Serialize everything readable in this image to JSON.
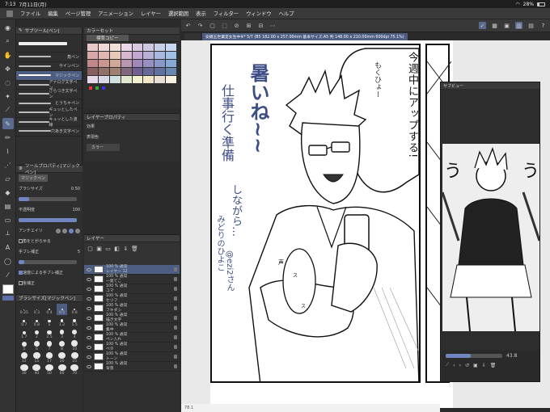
{
  "status": {
    "time": "7:13",
    "date": "7月11日(月)",
    "battery": "28%"
  },
  "menu": [
    "ファイル",
    "編集",
    "ページ管理",
    "アニメーション",
    "レイヤー",
    "選択範囲",
    "表示",
    "フィルター",
    "ウィンドウ",
    "ヘルプ"
  ],
  "subtool": {
    "title": "サブツール[ペン]",
    "items": [
      {
        "label": "角ペン",
        "selected": false
      },
      {
        "label": "サインペン",
        "selected": false
      },
      {
        "label": "マジックペン",
        "selected": true
      },
      {
        "label": "アナログ文字ペン",
        "selected": false
      },
      {
        "label": "ざらつき文字ペン",
        "selected": false
      },
      {
        "label": "とうちゃペン",
        "selected": false
      },
      {
        "label": "ギュッとしたペン",
        "selected": false
      },
      {
        "label": "キュッとした波線",
        "selected": false
      },
      {
        "label": "穴あき文字ペン",
        "selected": false
      }
    ]
  },
  "toolprop": {
    "title": "ツールプロパティ[マジックペン]",
    "name": "マジックペン",
    "brush_size_label": "ブラシサイズ",
    "brush_size_value": "0.50",
    "opacity_label": "不透明度",
    "opacity_value": "100",
    "antialias_label": "アンチエイリ",
    "corner_label": "角をとがらせる",
    "stabilize_label": "手ブレ補正",
    "stabilize_value": "5",
    "speed_label": "速度による手ブレ補正",
    "post_label": "後補正"
  },
  "sizepanel": {
    "title": "ブラシサイズ[マジックペン]",
    "sizes": [
      "0.25",
      "0.3",
      "0.4",
      "0.5",
      "0.6",
      "0.7",
      "0.8",
      "1",
      "1.2",
      "1.5",
      "1.7",
      "2",
      "2.5",
      "3",
      "4",
      "5",
      "6",
      "7",
      "8",
      "10",
      "12",
      "15",
      "17",
      "20",
      "25",
      "30",
      "40",
      "50",
      "60",
      "70"
    ]
  },
  "colorset": {
    "title": "カラーセット",
    "preset": "標準コピー",
    "colors": [
      "#e8c8c8",
      "#f0d8d8",
      "#f0e0d8",
      "#e8d8e8",
      "#d8c8e0",
      "#d0c8e0",
      "#c8d0e8",
      "#c8d8f0",
      "#d8a8a8",
      "#e0b8b0",
      "#e8c8b8",
      "#d8b8d0",
      "#c0a8d0",
      "#b8b0d8",
      "#a8b8e0",
      "#a0c0e8",
      "#c08888",
      "#c89890",
      "#d0a898",
      "#b898b0",
      "#a088b8",
      "#9890c0",
      "#8898c8",
      "#88a8d8",
      "#886060",
      "#907068",
      "#a08070",
      "#806880",
      "#706090",
      "#686898",
      "#6070a0",
      "#6888b0",
      "#e8d8e8",
      "#d8d8e8",
      "#d0e0e0",
      "#e0e8d0",
      "#f0f0d0",
      "#f0e8c8",
      "#e8e0d8",
      "#f8f0e0"
    ]
  },
  "layerprop": {
    "title": "レイヤープロパティ",
    "effect_label": "効果",
    "color_label": "表現色",
    "color_value": "カラー"
  },
  "layers": {
    "title": "レイヤー",
    "items": [
      {
        "percent": "100 %",
        "mode": "通常",
        "name": "レイヤー 12",
        "selected": true
      },
      {
        "percent": "100 %",
        "mode": "通常",
        "name": "一発てこ",
        "selected": false
      },
      {
        "percent": "100 %",
        "mode": "通常",
        "name": "コマ",
        "selected": false
      },
      {
        "percent": "100 %",
        "mode": "通常",
        "name": "セリフ",
        "selected": false
      },
      {
        "percent": "100 %",
        "mode": "通常",
        "name": "フキダシ",
        "selected": false
      },
      {
        "percent": "100 %",
        "mode": "通常",
        "name": "描き文字",
        "selected": false
      },
      {
        "percent": "100 %",
        "mode": "通常",
        "name": "集中",
        "selected": false
      },
      {
        "percent": "100 %",
        "mode": "通常",
        "name": "ペン入れ",
        "selected": false
      },
      {
        "percent": "100 %",
        "mode": "通常",
        "name": "ベタ",
        "selected": false
      },
      {
        "percent": "100 %",
        "mode": "通常",
        "name": "トーン",
        "selected": false
      },
      {
        "percent": "100 %",
        "mode": "通常",
        "name": "背景",
        "selected": false
      }
    ]
  },
  "tab": {
    "label": "安錦五世業変女生中※* 5/7 (B5 182.00 x 257.00mm 基本サイズ:A5 判 148.00 x 210.00mm 600dpi 75.1%)"
  },
  "canvas": {
    "bubble_text": "今週中にアップする!",
    "bubble_small": "もくひょー",
    "hand_text_1": "暑いね~~",
    "hand_text_2": "仕事行く準備",
    "hand_text_3": "しながら…",
    "hand_text_4": "みどりのひよこ",
    "hand_text_5": "@ezi2さん",
    "sfx_1": "声",
    "sfx_2": "ス",
    "sfx_3": "ス"
  },
  "zoom": "78.1",
  "subview": {
    "title": "サブビュー",
    "zoom": "43.8",
    "sfx": "う"
  }
}
